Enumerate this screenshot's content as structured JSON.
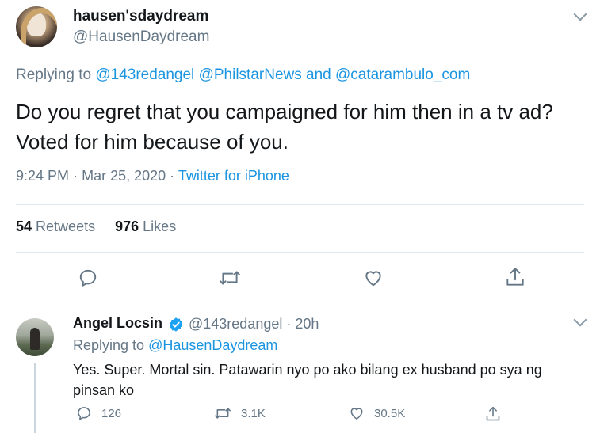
{
  "main_tweet": {
    "display_name": "hausen'sdaydream",
    "handle": "@HausenDaydream",
    "replying_prefix": "Replying to",
    "replying_mentions": [
      "@143redangel",
      "@PhilstarNews"
    ],
    "replying_and": "and",
    "replying_last": "@catarambulo_com",
    "text": "Do you regret that you campaigned for him then in a tv ad? Voted for him because of you.",
    "time": "9:24 PM",
    "date": "Mar 25, 2020",
    "separator": "·",
    "source": "Twitter for iPhone",
    "retweets_count": "54",
    "retweets_label": "Retweets",
    "likes_count": "976",
    "likes_label": "Likes"
  },
  "reply_tweet": {
    "display_name": "Angel Locsin",
    "handle_time": "@143redangel · 20h",
    "replying_prefix": "Replying to",
    "replying_mention": "@HausenDaydream",
    "text": "Yes. Super. Mortal sin. Patawarin nyo po ako bilang ex husband po sya ng pinsan ko",
    "reply_count": "126",
    "retweet_count": "3.1K",
    "like_count": "30.5K"
  },
  "colors": {
    "link": "#1b95e0",
    "muted": "#657786",
    "text": "#14171a",
    "divider": "#e1e8ed",
    "verified": "#1da1f2"
  },
  "icons": {
    "reply": "reply-icon",
    "retweet": "retweet-icon",
    "like": "heart-icon",
    "share": "share-icon",
    "more": "chevron-down-icon",
    "verified": "verified-badge-icon"
  }
}
